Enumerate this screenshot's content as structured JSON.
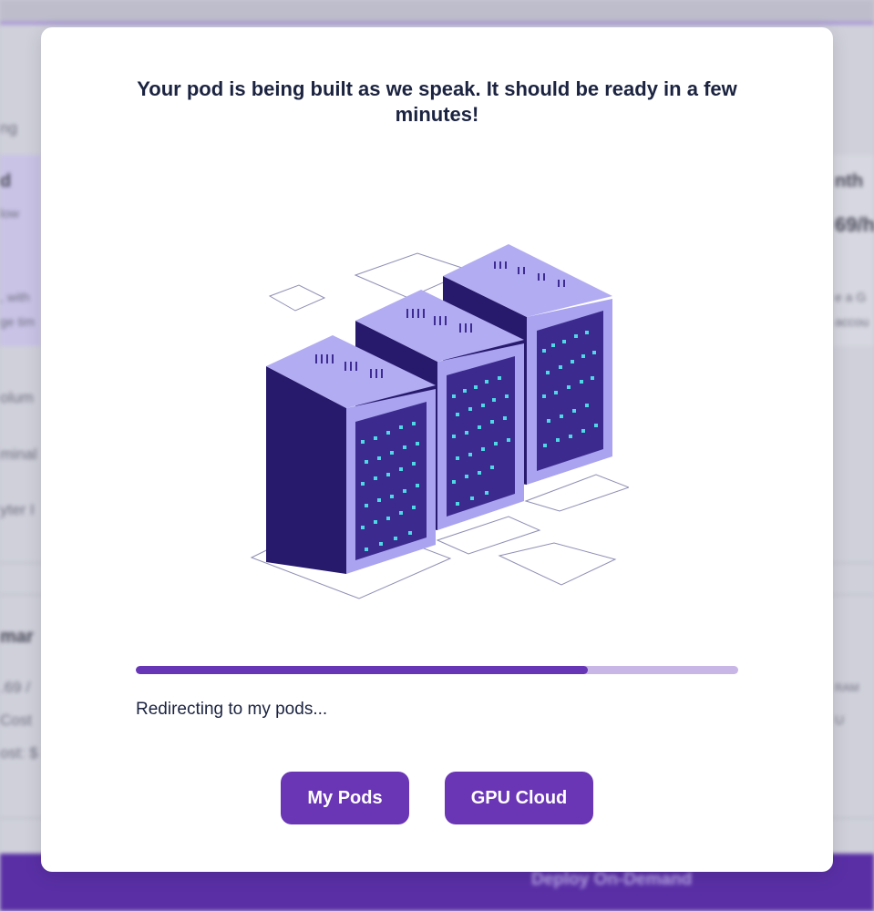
{
  "background": {
    "left_snippets": [
      "ng",
      "d",
      "low",
      ", with",
      "ge tim",
      "olum",
      "minal",
      "yter I",
      "mar",
      ".69 /",
      "Cost",
      "ost: $"
    ],
    "right_snippets": [
      "nth",
      "69/h",
      "e a G",
      "accou",
      "RAM",
      "U"
    ],
    "deploy_label": "Deploy On-Demand"
  },
  "modal": {
    "title": "Your pod is being built as we speak. It should be ready in a few minutes!",
    "illustration_icon": "server-racks-illustration",
    "progress": 0.75,
    "status_text": "Redirecting to my pods...",
    "buttons": {
      "my_pods": "My Pods",
      "gpu_cloud": "GPU Cloud"
    }
  },
  "colors": {
    "accent": "#6a36b5",
    "progress_fill": "#6736b6",
    "progress_track": "#c7b6e6",
    "server_dark": "#27196c",
    "server_light": "#a9a3f0",
    "server_led": "#4fd8e6",
    "deploy_bar": "#5a2fa6"
  }
}
